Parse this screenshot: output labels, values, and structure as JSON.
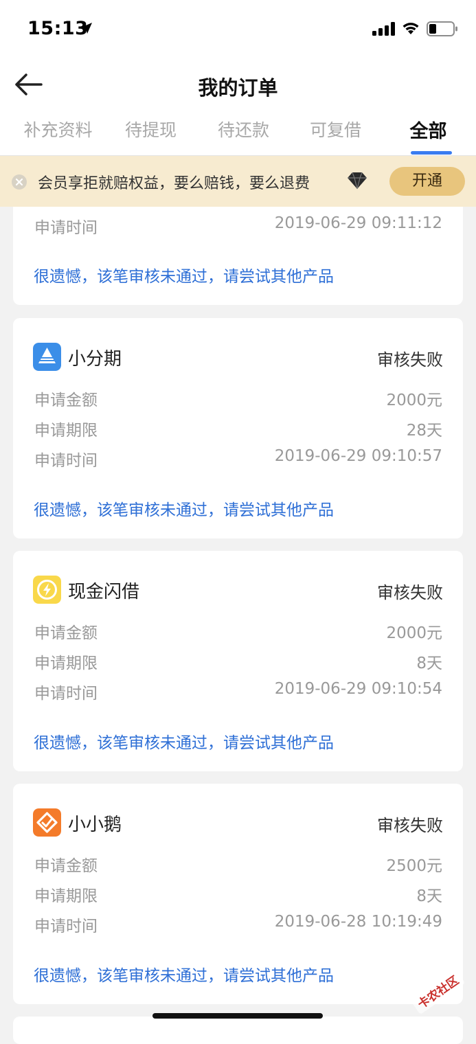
{
  "status_bar": {
    "time": "15:13"
  },
  "nav": {
    "title": "我的订单"
  },
  "tabs": [
    {
      "label": "补充资料"
    },
    {
      "label": "待提现"
    },
    {
      "label": "待还款"
    },
    {
      "label": "可复借"
    },
    {
      "label": "全部",
      "active": true
    }
  ],
  "banner": {
    "text": "会员享拒就赔权益，要么赔钱，要么退费",
    "button": "开通"
  },
  "partial_card": {
    "time_label": "申请时间",
    "time_value": "2019-06-29 09:11:12",
    "notice": "很遗憾，该笔审核未通过，请尝试其他产品"
  },
  "orders": [
    {
      "name": "小分期",
      "status": "审核失败",
      "logo_icon": "pyramid-icon",
      "amount_label": "申请金额",
      "amount": "2000元",
      "term_label": "申请期限",
      "term": "28天",
      "time_label": "申请时间",
      "time": "2019-06-29 09:10:57",
      "notice": "很遗憾，该笔审核未通过，请尝试其他产品"
    },
    {
      "name": "现金闪借",
      "status": "审核失败",
      "logo_icon": "lightning-icon",
      "amount_label": "申请金额",
      "amount": "2000元",
      "term_label": "申请期限",
      "term": "8天",
      "time_label": "申请时间",
      "time": "2019-06-29 09:10:54",
      "notice": "很遗憾，该笔审核未通过，请尝试其他产品"
    },
    {
      "name": "小小鹅",
      "status": "审核失败",
      "logo_icon": "diamond-link-icon",
      "amount_label": "申请金额",
      "amount": "2500元",
      "term_label": "申请期限",
      "term": "8天",
      "time_label": "申请时间",
      "time": "2019-06-28 10:19:49",
      "notice": "很遗憾，该笔审核未通过，请尝试其他产品"
    }
  ],
  "watermark": {
    "text": "卡农社区"
  },
  "colors": {
    "accent": "#3a7cf0",
    "notice": "#2e6fd6",
    "banner_bg": "#f7ebd0",
    "banner_button": "#e8c57d",
    "logo_blue": "#3b8ee8",
    "logo_yellow": "#f9d84a",
    "logo_orange": "#f47b2a"
  }
}
